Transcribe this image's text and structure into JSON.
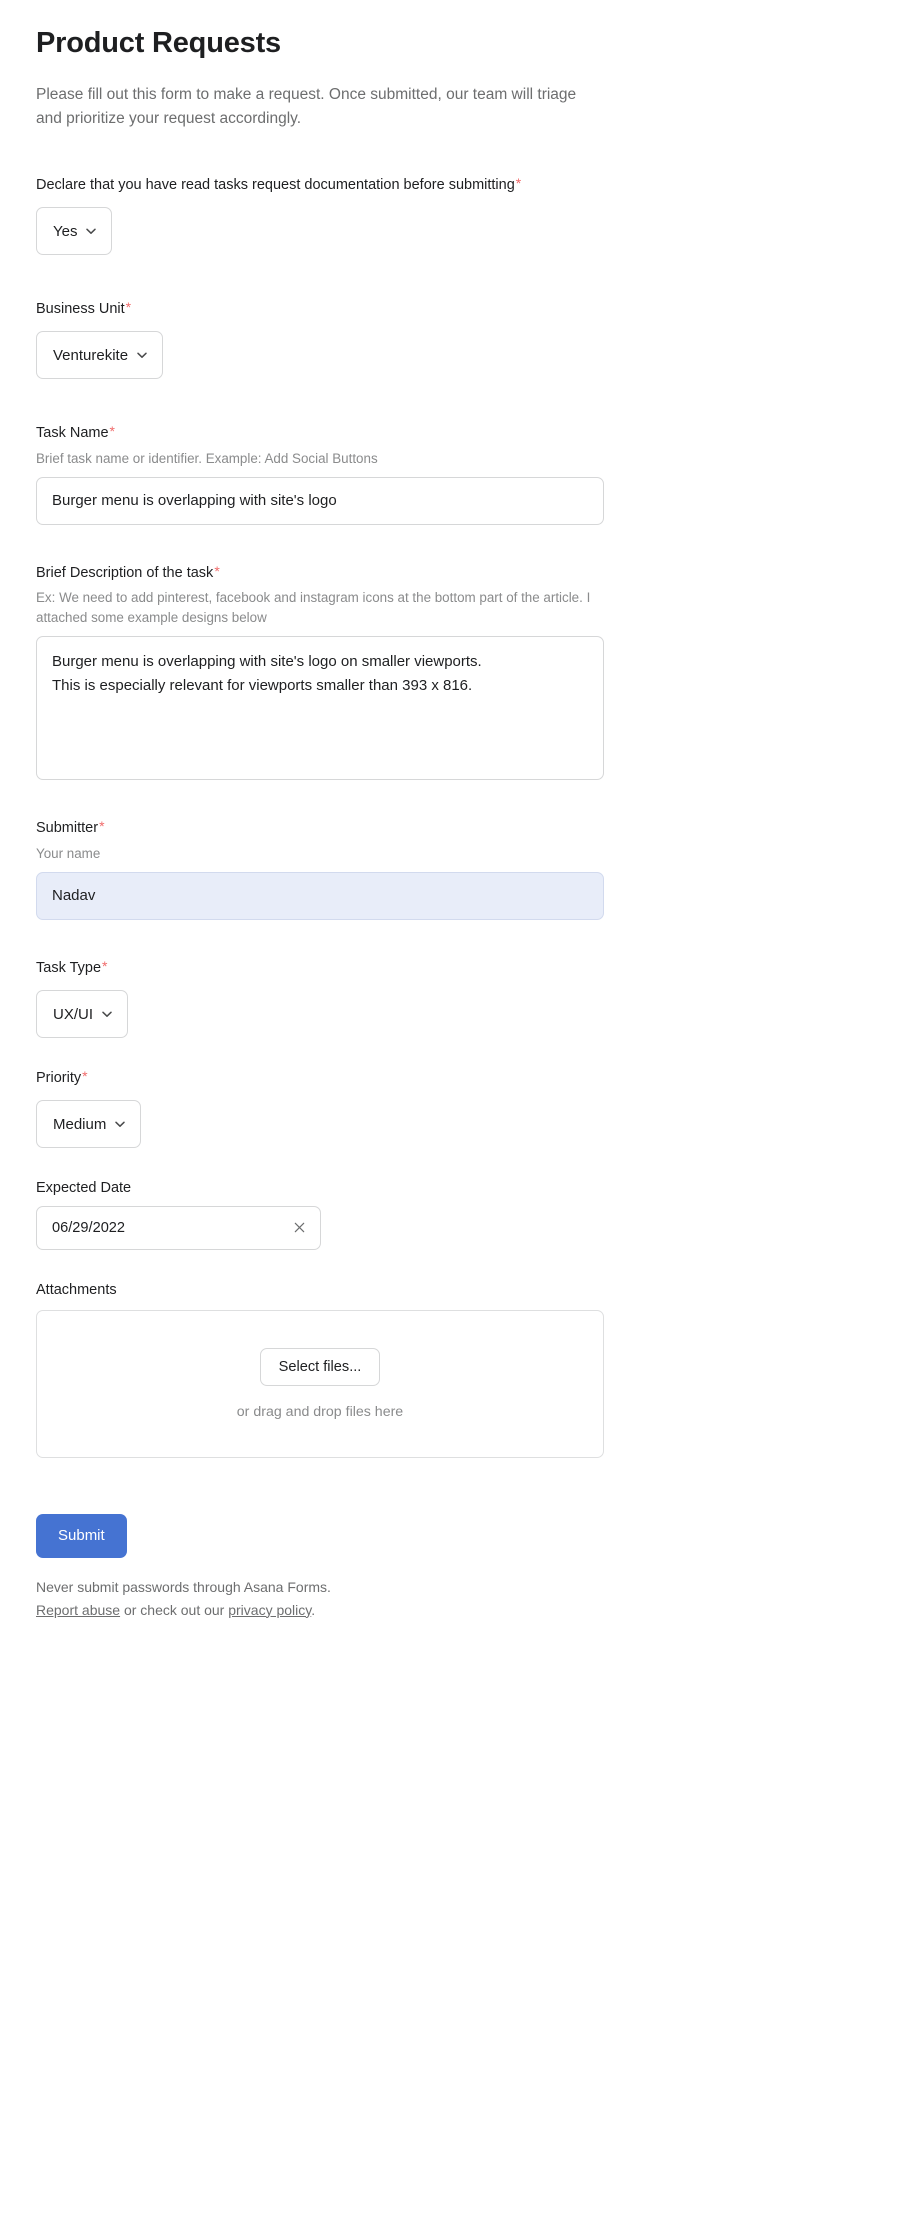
{
  "form": {
    "title": "Product Requests",
    "intro": "Please fill out this form to make a request. Once submitted, our team will triage and prioritize your request accordingly."
  },
  "fields": {
    "declaration": {
      "label": "Declare that you have read tasks request documentation before submitting",
      "required_marker": "*",
      "value": "Yes",
      "chevron_icon": "chevron-down-icon"
    },
    "business_unit": {
      "label": "Business Unit",
      "required_marker": "*",
      "value": "Venturekite",
      "chevron_icon": "chevron-down-icon"
    },
    "task_name": {
      "label": "Task Name",
      "required_marker": "*",
      "help": "Brief task name or identifier. Example: Add Social Buttons",
      "value": "Burger menu is overlapping with site's logo",
      "placeholder": ""
    },
    "description": {
      "label": "Brief Description of the task",
      "required_marker": "*",
      "help": "Ex: We need to add pinterest, facebook and instagram icons at the bottom part of the article. I attached some example designs below",
      "value": "Burger menu is overlapping with site's logo on smaller viewports.\nThis is especially relevant for viewports smaller than 393 x 816.",
      "placeholder": ""
    },
    "submitter": {
      "label": "Submitter",
      "required_marker": "*",
      "help": "Your name",
      "value": "Nadav",
      "placeholder": ""
    },
    "task_type": {
      "label": "Task Type",
      "required_marker": "*",
      "value": "UX/UI",
      "chevron_icon": "chevron-down-icon"
    },
    "priority": {
      "label": "Priority",
      "required_marker": "*",
      "value": "Medium",
      "chevron_icon": "chevron-down-icon"
    },
    "expected_date": {
      "label": "Expected Date",
      "value": "06/29/2022",
      "clear_icon": "close-icon"
    },
    "attachments": {
      "label": "Attachments",
      "select_files_label": "Select files...",
      "drag_hint": "or drag and drop files here"
    }
  },
  "actions": {
    "submit_label": "Submit"
  },
  "footer": {
    "warning": "Never submit passwords through Asana Forms.",
    "report_abuse_label": "Report abuse",
    "middle_text": " or check out our ",
    "privacy_policy_label": "privacy policy",
    "trailing_text": "."
  },
  "colors": {
    "accent": "#4573d2",
    "required": "#f06a6a",
    "focus_field_bg": "#e8edf9",
    "border": "#d6d7d8",
    "muted_text": "#6d6e6f"
  }
}
